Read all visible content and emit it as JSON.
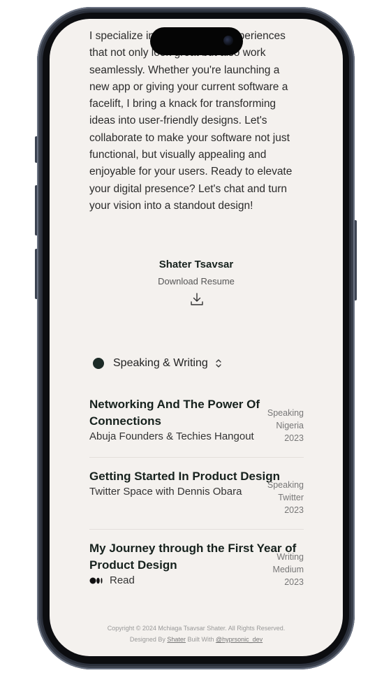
{
  "bio": "I specialize in crafting digital experiences that not only look great but also work seamlessly. Whether you're launching a new app or giving your current software a facelift, I bring a knack for transforming ideas into user-friendly designs. Let's collaborate to make your software not just functional, but visually appealing and enjoyable for your users. Ready to elevate your digital presence? Let's chat and turn your vision into a standout design!",
  "profile": {
    "name": "Shater Tsavsar",
    "resume_label": "Download Resume"
  },
  "section": {
    "label": "Speaking & Writing"
  },
  "items": [
    {
      "title": "Networking And The Power Of Connections",
      "subtitle": "Abuja Founders & Techies Hangout",
      "type": "Speaking",
      "venue": "Nigeria",
      "year": "2023"
    },
    {
      "title": "Getting Started In Product Design",
      "subtitle": "Twitter Space with Dennis Obara",
      "type": "Speaking",
      "venue": "Twitter",
      "year": "2023"
    },
    {
      "title": "My Journey through the First Year of Product Design",
      "subtitle": "Read",
      "type": "Writing",
      "venue": "Medium",
      "year": "2023"
    }
  ],
  "footer": {
    "copyright": "Copyright © 2024 Mchiaga Tsavsar Shater. All Rights Reserved.",
    "designed_by_label": "Designed By",
    "designer": "Shater",
    "built_with_label": "Built With",
    "builder": "@hyprsonic_dev"
  },
  "colors": {
    "background": "#f4f1ee",
    "accent": "#1c2b27",
    "frame": "#2a2f3a"
  }
}
